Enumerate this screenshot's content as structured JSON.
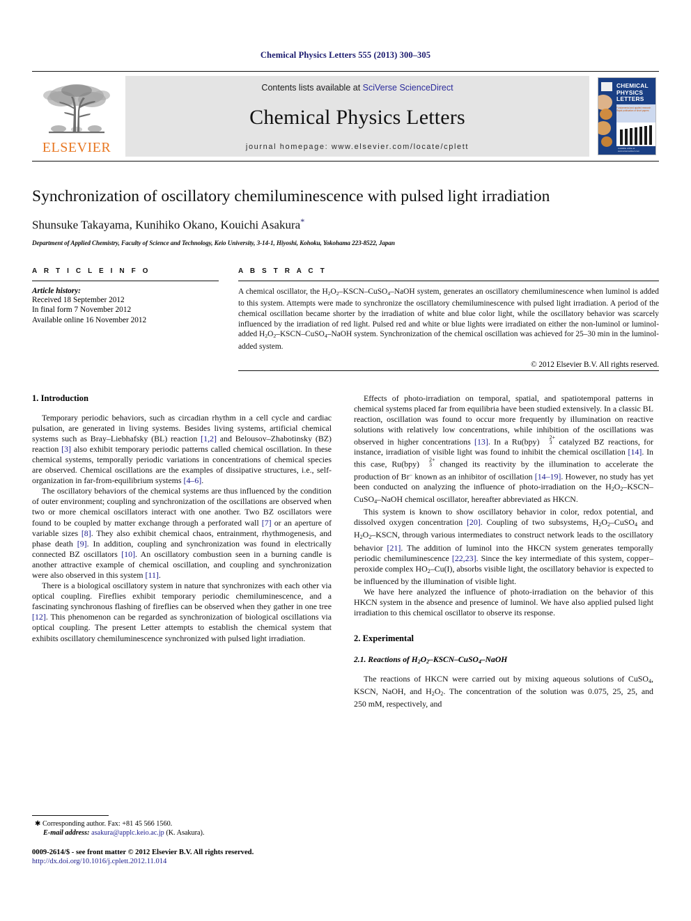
{
  "running_head": "Chemical Physics Letters 555 (2013) 300–305",
  "masthead": {
    "contents_prefix": "Contents lists available at ",
    "sciencedirect_link": "SciVerse ScienceDirect",
    "journal_title": "Chemical Physics Letters",
    "homepage_label": "journal homepage: www.elsevier.com/locate/cplett",
    "publisher_name": "ELSEVIER",
    "cover": {
      "title_line1": "CHEMICAL",
      "title_line2": "PHYSICS",
      "title_line3": "LETTERS",
      "subtitle_line1": "Fundamental and applied research",
      "subtitle_line2": "Rapid publication of short papers",
      "footer": "Available online at www.sciencedirect.com"
    }
  },
  "article": {
    "title": "Synchronization of oscillatory chemiluminescence with pulsed light irradiation",
    "authors": "Shunsuke Takayama, Kunihiko Okano, Kouichi Asakura",
    "corresponding_marker": "*",
    "affiliation": "Department of Applied Chemistry, Faculty of Science and Technology, Keio University, 3-14-1, Hiyoshi, Kohoku, Yokohama 223-8522, Japan"
  },
  "article_info": {
    "heading": "A R T I C L E  I N F O",
    "history_label": "Article history:",
    "received": "Received 18 September 2012",
    "final_form": "In final form 7 November 2012",
    "available_online": "Available online 16 November 2012"
  },
  "abstract": {
    "heading": "A B S T R A C T",
    "copyright": "© 2012 Elsevier B.V. All rights reserved."
  },
  "sections": {
    "introduction_heading": "1. Introduction",
    "experimental_heading": "2. Experimental",
    "experimental_subheading": "2.1. Reactions of H2O2–KSCN–CuSO4–NaOH"
  },
  "footnotes": {
    "corresponding": "Corresponding author. Fax: +81 45 566 1560.",
    "email_label": "E-mail address:",
    "email": "asakura@applc.keio.ac.jp",
    "email_owner": "(K. Asakura).",
    "issn_line": "0009-2614/$ - see front matter © 2012 Elsevier B.V. All rights reserved.",
    "doi": "http://dx.doi.org/10.1016/j.cplett.2012.11.014"
  },
  "colors": {
    "elsevier_orange": "#E87722",
    "link_blue": "#2b2b9c",
    "reference_blue": "#1a1a8c",
    "running_head_navy": "#1a1a6e",
    "masthead_gray": "#e4e4e4",
    "cover_blue": "#1a3f84"
  }
}
